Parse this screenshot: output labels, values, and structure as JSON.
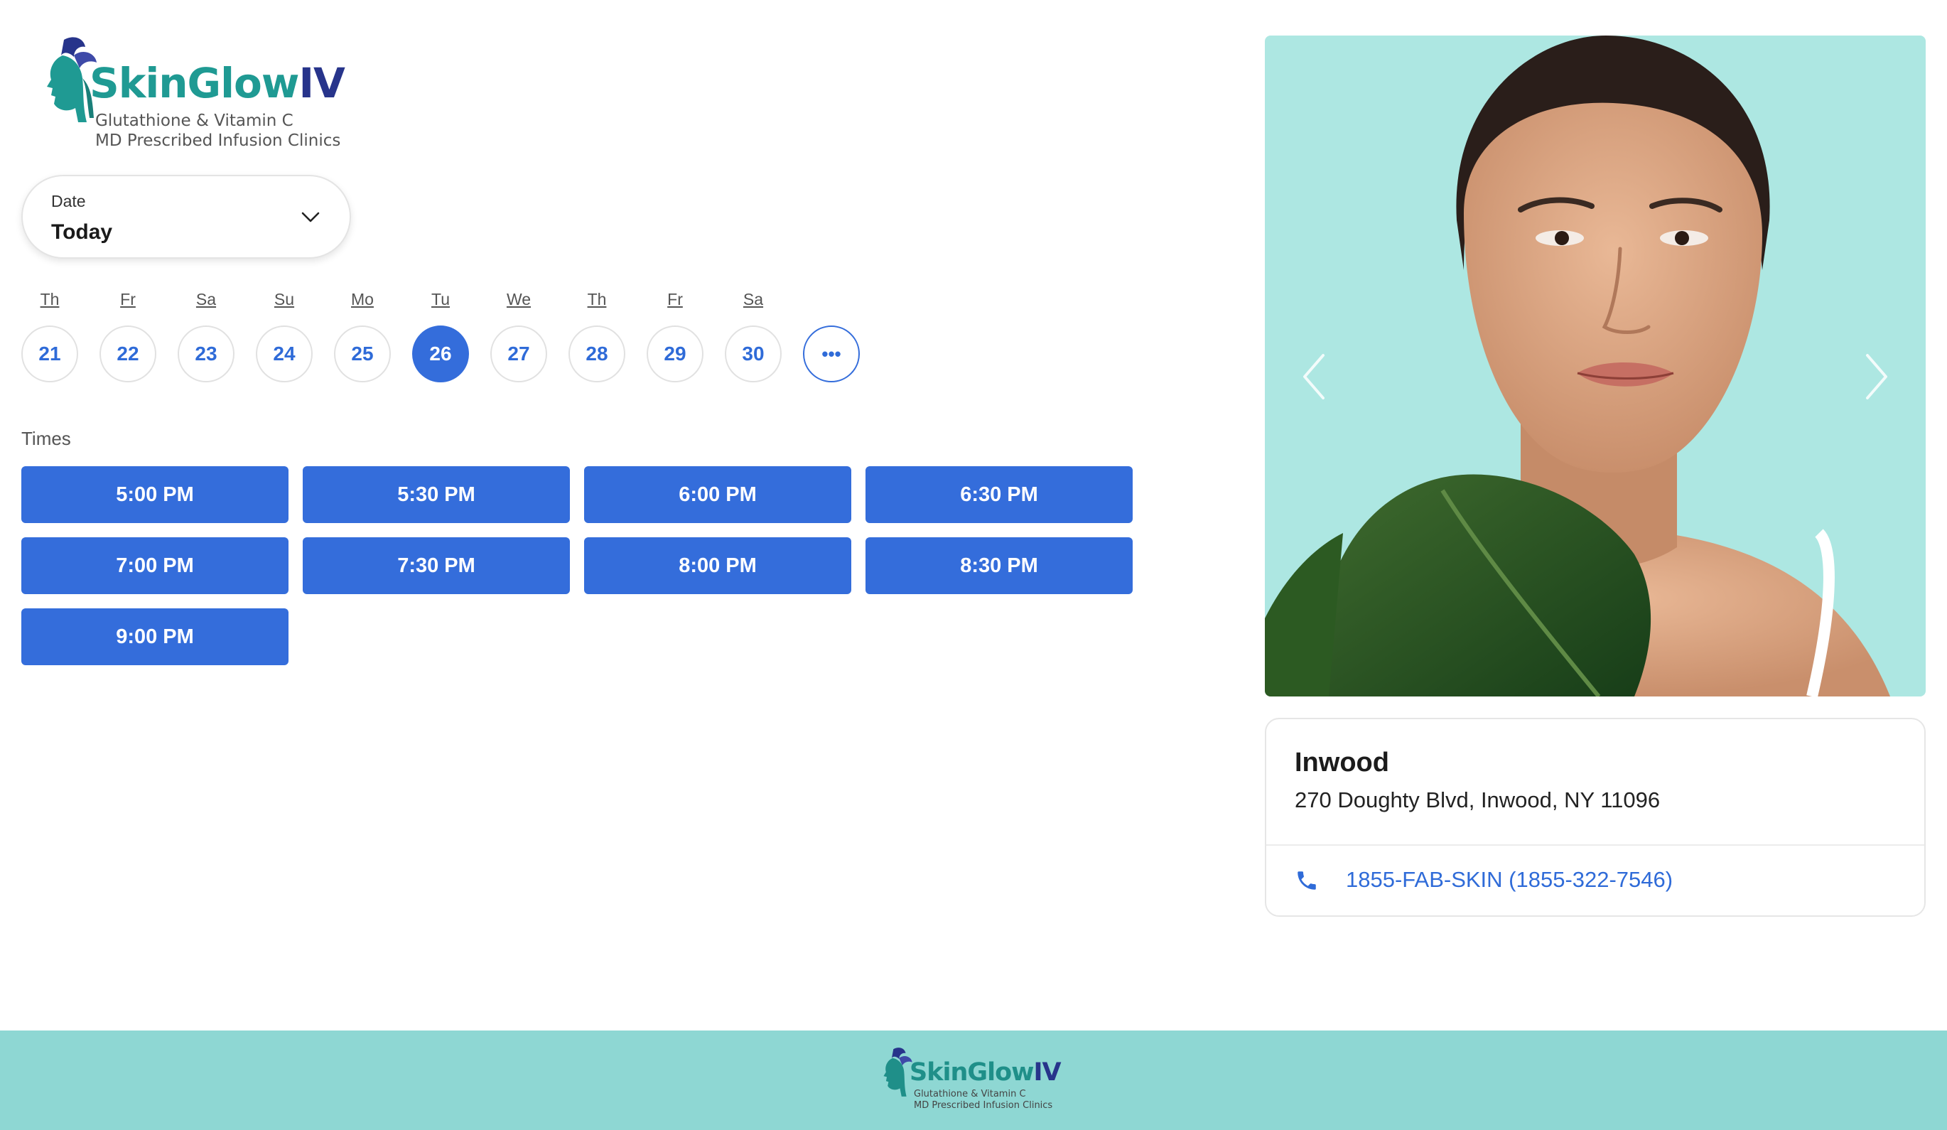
{
  "brand": {
    "name_part1": "SkinGlow",
    "name_part2": "IV",
    "tagline_line1": "Glutathione & Vitamin C",
    "tagline_line2": "MD Prescribed Infusion Clinics",
    "colors": {
      "teal": "#1f9a93",
      "navy": "#27348b"
    }
  },
  "date_selector": {
    "label": "Date",
    "value": "Today"
  },
  "days": [
    {
      "name": "Th",
      "num": "21",
      "selected": false
    },
    {
      "name": "Fr",
      "num": "22",
      "selected": false
    },
    {
      "name": "Sa",
      "num": "23",
      "selected": false
    },
    {
      "name": "Su",
      "num": "24",
      "selected": false
    },
    {
      "name": "Mo",
      "num": "25",
      "selected": false
    },
    {
      "name": "Tu",
      "num": "26",
      "selected": true
    },
    {
      "name": "We",
      "num": "27",
      "selected": false
    },
    {
      "name": "Th",
      "num": "28",
      "selected": false
    },
    {
      "name": "Fr",
      "num": "29",
      "selected": false
    },
    {
      "name": "Sa",
      "num": "30",
      "selected": false
    }
  ],
  "more_days_label": "•••",
  "times": {
    "label": "Times",
    "slots": [
      "5:00 PM",
      "5:30 PM",
      "6:00 PM",
      "6:30 PM",
      "7:00 PM",
      "7:30 PM",
      "8:00 PM",
      "8:30 PM",
      "9:00 PM"
    ]
  },
  "location": {
    "name": "Inwood",
    "address": "270 Doughty Blvd, Inwood, NY 11096",
    "phone": "1855-FAB-SKIN (1855-322-7546)"
  },
  "icons": {
    "date_chevron": "chevron-down-icon",
    "carousel_prev": "chevron-left-icon",
    "carousel_next": "chevron-right-icon",
    "phone": "phone-icon"
  },
  "colors": {
    "accent": "#346ddb",
    "photo_bg": "#ade7e2",
    "footer_bg": "#8ed7d3"
  }
}
